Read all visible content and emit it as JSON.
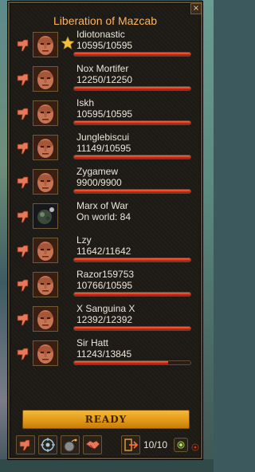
{
  "window": {
    "title": "Liberation of Mazcab",
    "close_label": "×"
  },
  "members": [
    {
      "name": "Idiotonastic",
      "hp": "10595/10595",
      "hp_fraction": 1.0,
      "leader": true,
      "portrait": "face-icon"
    },
    {
      "name": "Nox Mortifer",
      "hp": "12250/12250",
      "hp_fraction": 1.0,
      "leader": false,
      "portrait": "face-icon"
    },
    {
      "name": "Iskh",
      "hp": "10595/10595",
      "hp_fraction": 1.0,
      "leader": false,
      "portrait": "face-icon"
    },
    {
      "name": "Junglebiscui",
      "hp": "11149/10595",
      "hp_fraction": 1.0,
      "leader": false,
      "portrait": "face-icon"
    },
    {
      "name": "Zygamew",
      "hp": "9900/9900",
      "hp_fraction": 1.0,
      "leader": false,
      "portrait": "face-icon"
    },
    {
      "name": "Marx of War",
      "hp": "On world: 84",
      "hp_fraction": null,
      "leader": false,
      "portrait": "world-icon"
    },
    {
      "name": "Lzy",
      "hp": "11642/11642",
      "hp_fraction": 1.0,
      "leader": false,
      "portrait": "face-icon"
    },
    {
      "name": "Razor159753",
      "hp": "10766/10595",
      "hp_fraction": 1.0,
      "leader": false,
      "portrait": "face-icon"
    },
    {
      "name": "X Sanguina X",
      "hp": "12392/12392",
      "hp_fraction": 1.0,
      "leader": false,
      "portrait": "face-icon"
    },
    {
      "name": "Sir Hatt",
      "hp": "11243/13845",
      "hp_fraction": 0.81,
      "leader": false,
      "portrait": "face-icon"
    }
  ],
  "ready_label": "READY",
  "toolbar": {
    "buttons": [
      "kick-icon",
      "target-icon",
      "bomb-icon",
      "handshake-icon",
      "leave-icon"
    ],
    "count": "10/10"
  },
  "colors": {
    "accent": "#ffb45a",
    "hp": "#d22a14",
    "ready": "#e29a18"
  }
}
